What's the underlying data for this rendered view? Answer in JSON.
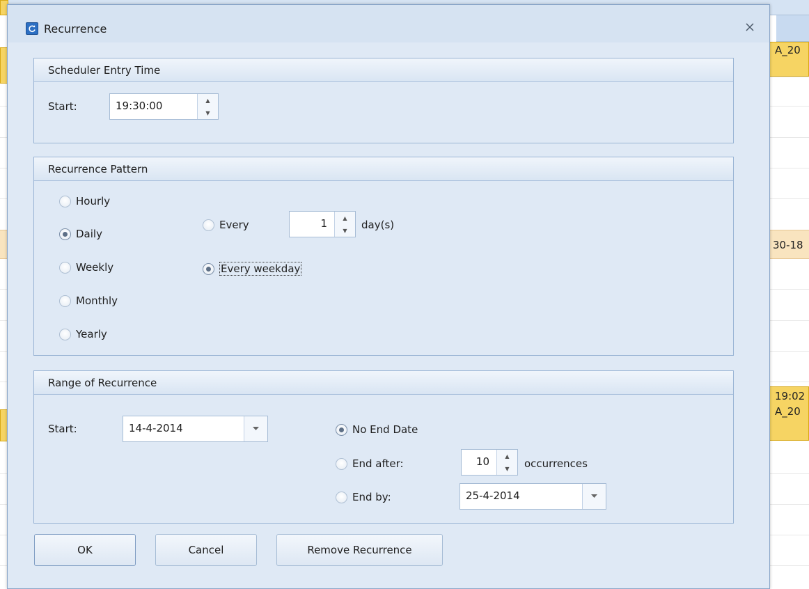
{
  "background": {
    "event_texts": [
      "A_20",
      "30-18",
      "19:02",
      "A_20"
    ]
  },
  "dialog": {
    "title": "Recurrence",
    "entry_time": {
      "header": "Scheduler Entry Time",
      "start_label": "Start:",
      "start_value": "19:30:00"
    },
    "pattern": {
      "header": "Recurrence Pattern",
      "options": [
        "Hourly",
        "Daily",
        "Weekly",
        "Monthly",
        "Yearly"
      ],
      "selected": "Daily",
      "every_label": "Every",
      "every_value": "1",
      "every_unit": "day(s)",
      "weekday_label": "Every weekday",
      "weekday_selected": true
    },
    "range": {
      "header": "Range of Recurrence",
      "start_label": "Start:",
      "start_value": "14-4-2014",
      "no_end_label": "No End Date",
      "end_after_label": "End after:",
      "end_after_value": "10",
      "occurrences_label": "occurrences",
      "end_by_label": "End by:",
      "end_by_value": "25-4-2014",
      "selected": "No End Date"
    },
    "buttons": {
      "ok": "OK",
      "cancel": "Cancel",
      "remove": "Remove Recurrence"
    }
  }
}
